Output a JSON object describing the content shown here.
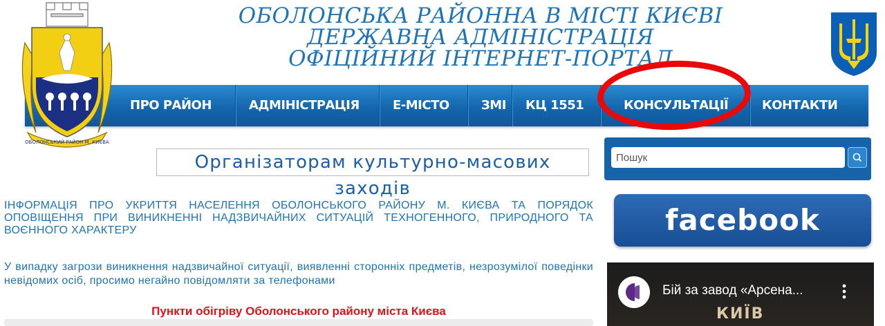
{
  "header": {
    "title_lines": [
      "ОБОЛОНСЬКА РАЙОННА В МІСТІ КИЄВІ",
      "ДЕРЖАВНА АДМІНІСТРАЦІЯ",
      "ОФІЦІЙНИЙ ІНТЕРНЕТ-ПОРТАЛ"
    ],
    "coat_text": "ОБОЛОНСЬКИЙ РАЙОН М. КИЄВА"
  },
  "nav": {
    "items": [
      {
        "label": "ПРО РАЙОН"
      },
      {
        "label": "АДМІНІСТРАЦІЯ"
      },
      {
        "label": "Е-МІСТО"
      },
      {
        "label": "ЗМІ"
      },
      {
        "label": "КЦ 1551"
      },
      {
        "label": "КОНСУЛЬТАЦІЇ"
      },
      {
        "label": "КОНТАКТИ"
      }
    ]
  },
  "main": {
    "heading": "Організаторам культурно-масових заходів",
    "info_link": "ІНФОРМАЦІЯ ПРО УКРИТТЯ НАСЕЛЕННЯ ОБОЛОНСЬКОГО РАЙОНУ М. КИЄВА ТА ПОРЯДОК ОПОВІЩЕННЯ ПРИ ВИНИКНЕННІ НАДЗВИЧАЙНИХ СИТУАЦІЙ ТЕХНОГЕННОГО, ПРИРОДНОГО ТА ВОЄННОГО ХАРАКТЕРУ",
    "paragraph": "У випадку загрози виникнення надзвичайної ситуації, виявленні  сторонніх предметів, незрозумілої поведінки невідомих осіб, просимо негайно повідомляти за телефонами",
    "red_heading": "Пункти обігріву Оболонського району міста Києва"
  },
  "sidebar": {
    "search": {
      "placeholder": "Пошук"
    },
    "facebook_label": "facebook",
    "video": {
      "title": "Бій за завод «Арсена...",
      "caption": "КИЇВ"
    }
  },
  "colors": {
    "accent_blue": "#1d74b8",
    "nav_blue": "#1466ad",
    "highlight_red": "#e8090b",
    "heading_red": "#e1121a"
  },
  "icons": [
    "coat-of-arms-icon",
    "trident-icon",
    "search-icon",
    "channel-logo-icon",
    "more-vert-icon"
  ]
}
